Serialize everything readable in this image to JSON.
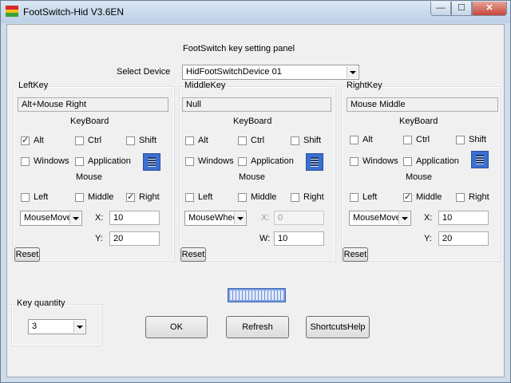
{
  "window": {
    "title": "FootSwitch-Hid V3.6EN",
    "minimize_glyph": "—",
    "maximize_glyph": "☐",
    "close_glyph": "✕"
  },
  "panel_title": "FootSwitch key setting panel",
  "device": {
    "label": "Select Device",
    "value": "HidFootSwitchDevice 01"
  },
  "groups": {
    "left": {
      "title": "LeftKey",
      "mapping": "Alt+Mouse Right",
      "keyboard_label": "KeyBoard",
      "alt": "Alt",
      "ctrl": "Ctrl",
      "shift": "Shift",
      "windows": "Windows",
      "application": "Application",
      "mouse_label": "Mouse",
      "left": "Left",
      "middle": "Middle",
      "right": "Right",
      "action": "MouseMove",
      "x_label": "X:",
      "x_value": "10",
      "y_label": "Y:",
      "y_value": "20",
      "reset": "Reset"
    },
    "middle": {
      "title": "MiddleKey",
      "mapping": "Null",
      "keyboard_label": "KeyBoard",
      "alt": "Alt",
      "ctrl": "Ctrl",
      "shift": "Shift",
      "windows": "Windows",
      "application": "Application",
      "mouse_label": "Mouse",
      "left": "Left",
      "middle": "Middle",
      "right": "Right",
      "action": "MouseWheel",
      "x_label": "X:",
      "x_value": "0",
      "w_label": "W:",
      "w_value": "10",
      "reset": "Reset"
    },
    "right": {
      "title": "RightKey",
      "mapping": "Mouse Middle",
      "keyboard_label": "KeyBoard",
      "alt": "Alt",
      "ctrl": "Ctrl",
      "shift": "Shift",
      "windows": "Windows",
      "application": "Application",
      "mouse_label": "Mouse",
      "left": "Left",
      "middle": "Middle",
      "right": "Right",
      "action": "MouseMove",
      "x_label": "X:",
      "x_value": "10",
      "y_label": "Y:",
      "y_value": "20",
      "reset": "Reset"
    }
  },
  "key_quantity": {
    "title": "Key quantity",
    "value": "3"
  },
  "buttons": {
    "ok": "OK",
    "refresh": "Refresh",
    "shortcuts": "ShortcutsHelp"
  },
  "colors": {
    "accent": "#3b6fd1",
    "frame": "#cfdcea",
    "close": "#c6463a"
  }
}
